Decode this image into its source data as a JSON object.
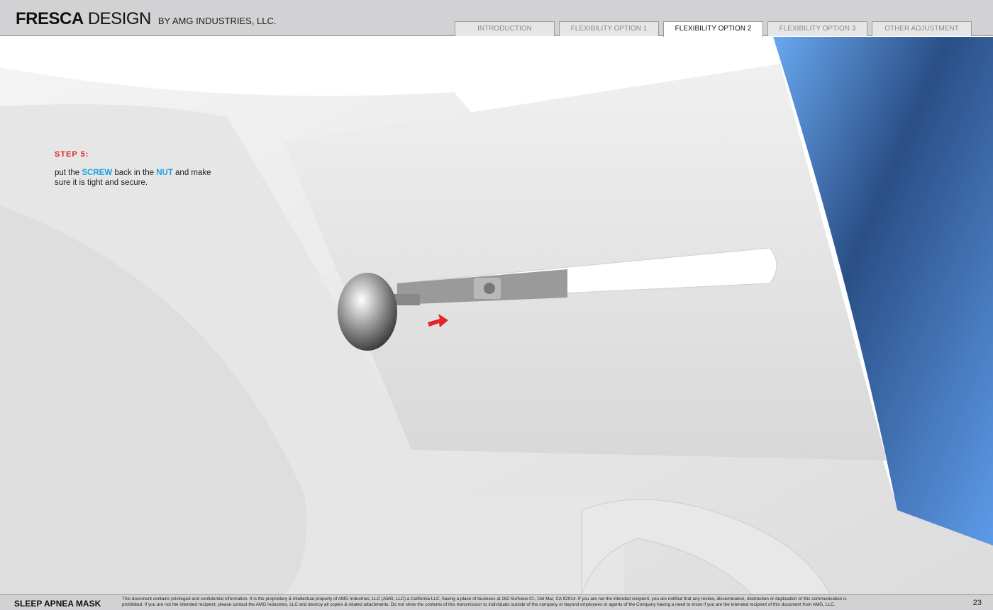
{
  "header": {
    "brand_bold": "FRESCA",
    "brand_light": "DESIGN",
    "brand_sub": "BY AMG INDUSTRIES, LLC.",
    "tabs": [
      {
        "label": "INTRODUCTION"
      },
      {
        "label": "FLEXIBILITY OPTION 1"
      },
      {
        "label": "FLEXIBILITY OPTION 2",
        "active": true
      },
      {
        "label": "FLEXIBILITY OPTION 3"
      },
      {
        "label": "OTHER ADJUSTMENT"
      }
    ]
  },
  "step": {
    "title": "STEP 5:",
    "t1": "put the ",
    "screw": "SCREW",
    "t2": " back in the ",
    "nut": "NUT",
    "t3": " and make sure it is tight and secure."
  },
  "footer": {
    "product": "SLEEP APNEA MASK",
    "legal": "This document contains privileged and confidential information. It is the proprietary & intellectual property of AMG Industries, LLC (AMG, LLC) a California LLC, having a place of business at 262 Surfview Ct., Del Mar, CA 92014. If you are not the intended recipient, you are notified that any review, dissemination, distribution or duplication of this communication is prohibited. If you are not the intended recipient, please contact the AMG Industries, LLC and destroy all copies & related attachments. Do not show the contents of this transmission to individuals outside of the company or beyond employees or agents of the Company having a need to know if you are the intended recipient of this document from AMG, LLC.",
    "page": "23"
  },
  "colors": {
    "accent_red": "#e2262b",
    "accent_blue": "#1aa0e0"
  }
}
